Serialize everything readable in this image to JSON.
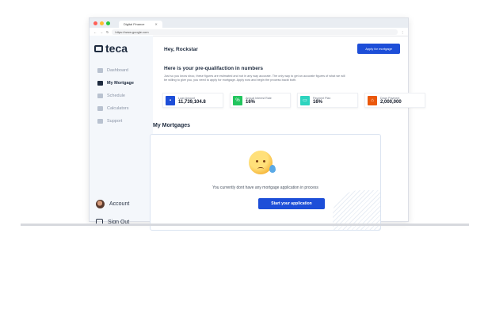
{
  "browser": {
    "tab_title": "Digital Finance",
    "url": "https://www.google.com",
    "traffic_colors": [
      "#ff5f57",
      "#febc2e",
      "#28c840"
    ]
  },
  "brand": {
    "name": "teca"
  },
  "sidebar": {
    "items": [
      {
        "label": "Dashboard",
        "icon": "grid-icon"
      },
      {
        "label": "My Mortgage",
        "icon": "house-icon",
        "active": true
      },
      {
        "label": "Schedule",
        "icon": "calendar-icon"
      },
      {
        "label": "Calculators",
        "icon": "calculator-icon"
      },
      {
        "label": "Support",
        "icon": "support-icon"
      }
    ],
    "account_label": "Account",
    "signout_label": "Sign Out"
  },
  "header": {
    "greeting": "Hey, Rockstar",
    "apply_label": "Apply for mortgage"
  },
  "prequal": {
    "title": "Here is your pre-qualifaction in numbers",
    "description": "Just so you know shoo, these figures are estimated and not in any way accurate. The only way to get an accurate figures of what we will be willing to give you, you need to apply for mortgage. Apply now and begin the process backt both."
  },
  "stats": [
    {
      "label": "Loan Amount",
      "value": "11,739,104.8",
      "color": "#1d4ed8",
      "icon": "users-icon"
    },
    {
      "label": "Annual Interest Rate",
      "value": "16%",
      "color": "#22c55e",
      "icon": "percent-icon"
    },
    {
      "label": "Payment Plan",
      "value": "16%",
      "color": "#2dd4bf",
      "icon": "wallet-icon"
    },
    {
      "label": "Down Payment",
      "value": "2,000,000",
      "color": "#ea580c",
      "icon": "home-icon"
    }
  ],
  "mortgages": {
    "title": "My Mortgages",
    "empty_text": "You currently dont have any mortgage application in process",
    "start_label": "Start your application"
  }
}
